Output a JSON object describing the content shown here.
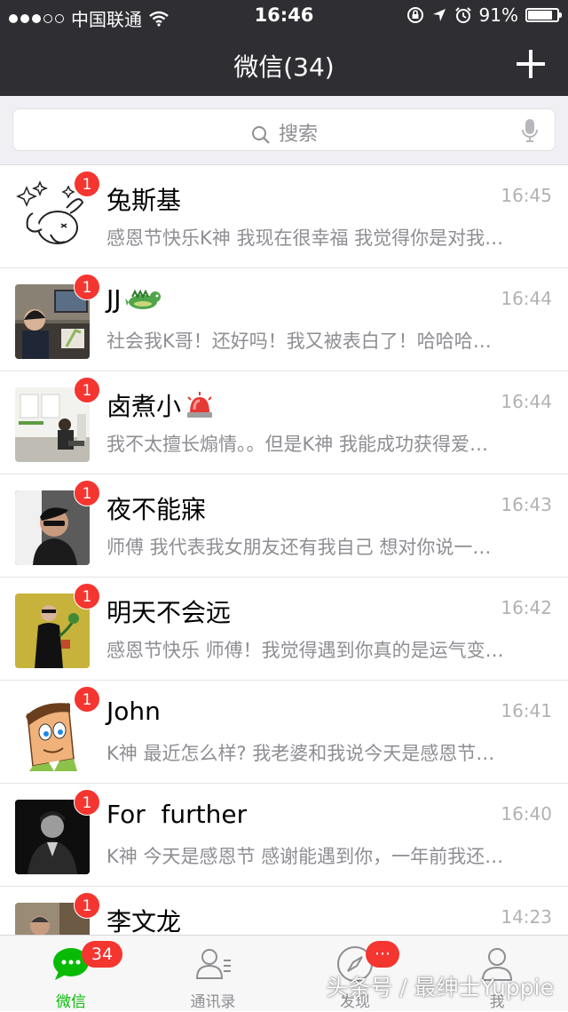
{
  "status_bar": {
    "carrier": "中国联通",
    "time": "16:46",
    "battery": "91%",
    "battery_level": 0.91
  },
  "nav": {
    "title": "微信(34)"
  },
  "search": {
    "placeholder": "搜索"
  },
  "chats": [
    {
      "name": "兔斯基",
      "time": "16:45",
      "preview": "感恩节快乐K神 我现在很幸福 我觉得你是对我…",
      "unread": "1"
    },
    {
      "name": "JJ",
      "time": "16:44",
      "preview": "社会我K哥！还好吗！我又被表白了！哈哈哈…",
      "unread": "1"
    },
    {
      "name": "卤煮小",
      "time": "16:44",
      "preview": "我不太擅长煽情。。但是K神 我能成功获得爱…",
      "unread": "1"
    },
    {
      "name": "夜不能寐",
      "time": "16:43",
      "preview": "师傅 我代表我女朋友还有我自己 想对你说一…",
      "unread": "1"
    },
    {
      "name": "明天不会远",
      "time": "16:42",
      "preview": "感恩节快乐 师傅！我觉得遇到你真的是运气变…",
      "unread": "1"
    },
    {
      "name": "John",
      "time": "16:41",
      "preview": "K神 最近怎么样? 我老婆和我说今天是感恩节…",
      "unread": "1"
    },
    {
      "name": "For  further",
      "time": "16:40",
      "preview": "K神 今天是感恩节 感谢能遇到你，一年前我还…",
      "unread": "1"
    },
    {
      "name": "李文龙",
      "time": "14:23",
      "preview": "",
      "unread": "1"
    }
  ],
  "tabs": [
    {
      "label": "微信",
      "badge": "34"
    },
    {
      "label": "通讯录"
    },
    {
      "label": "发现",
      "badge": "···"
    },
    {
      "label": "我"
    }
  ],
  "watermark": "头条号 / 最绅士Yuppie",
  "colors": {
    "header": "#2e2e33",
    "accent_green": "#09bb07",
    "badge_red": "#f43530"
  }
}
